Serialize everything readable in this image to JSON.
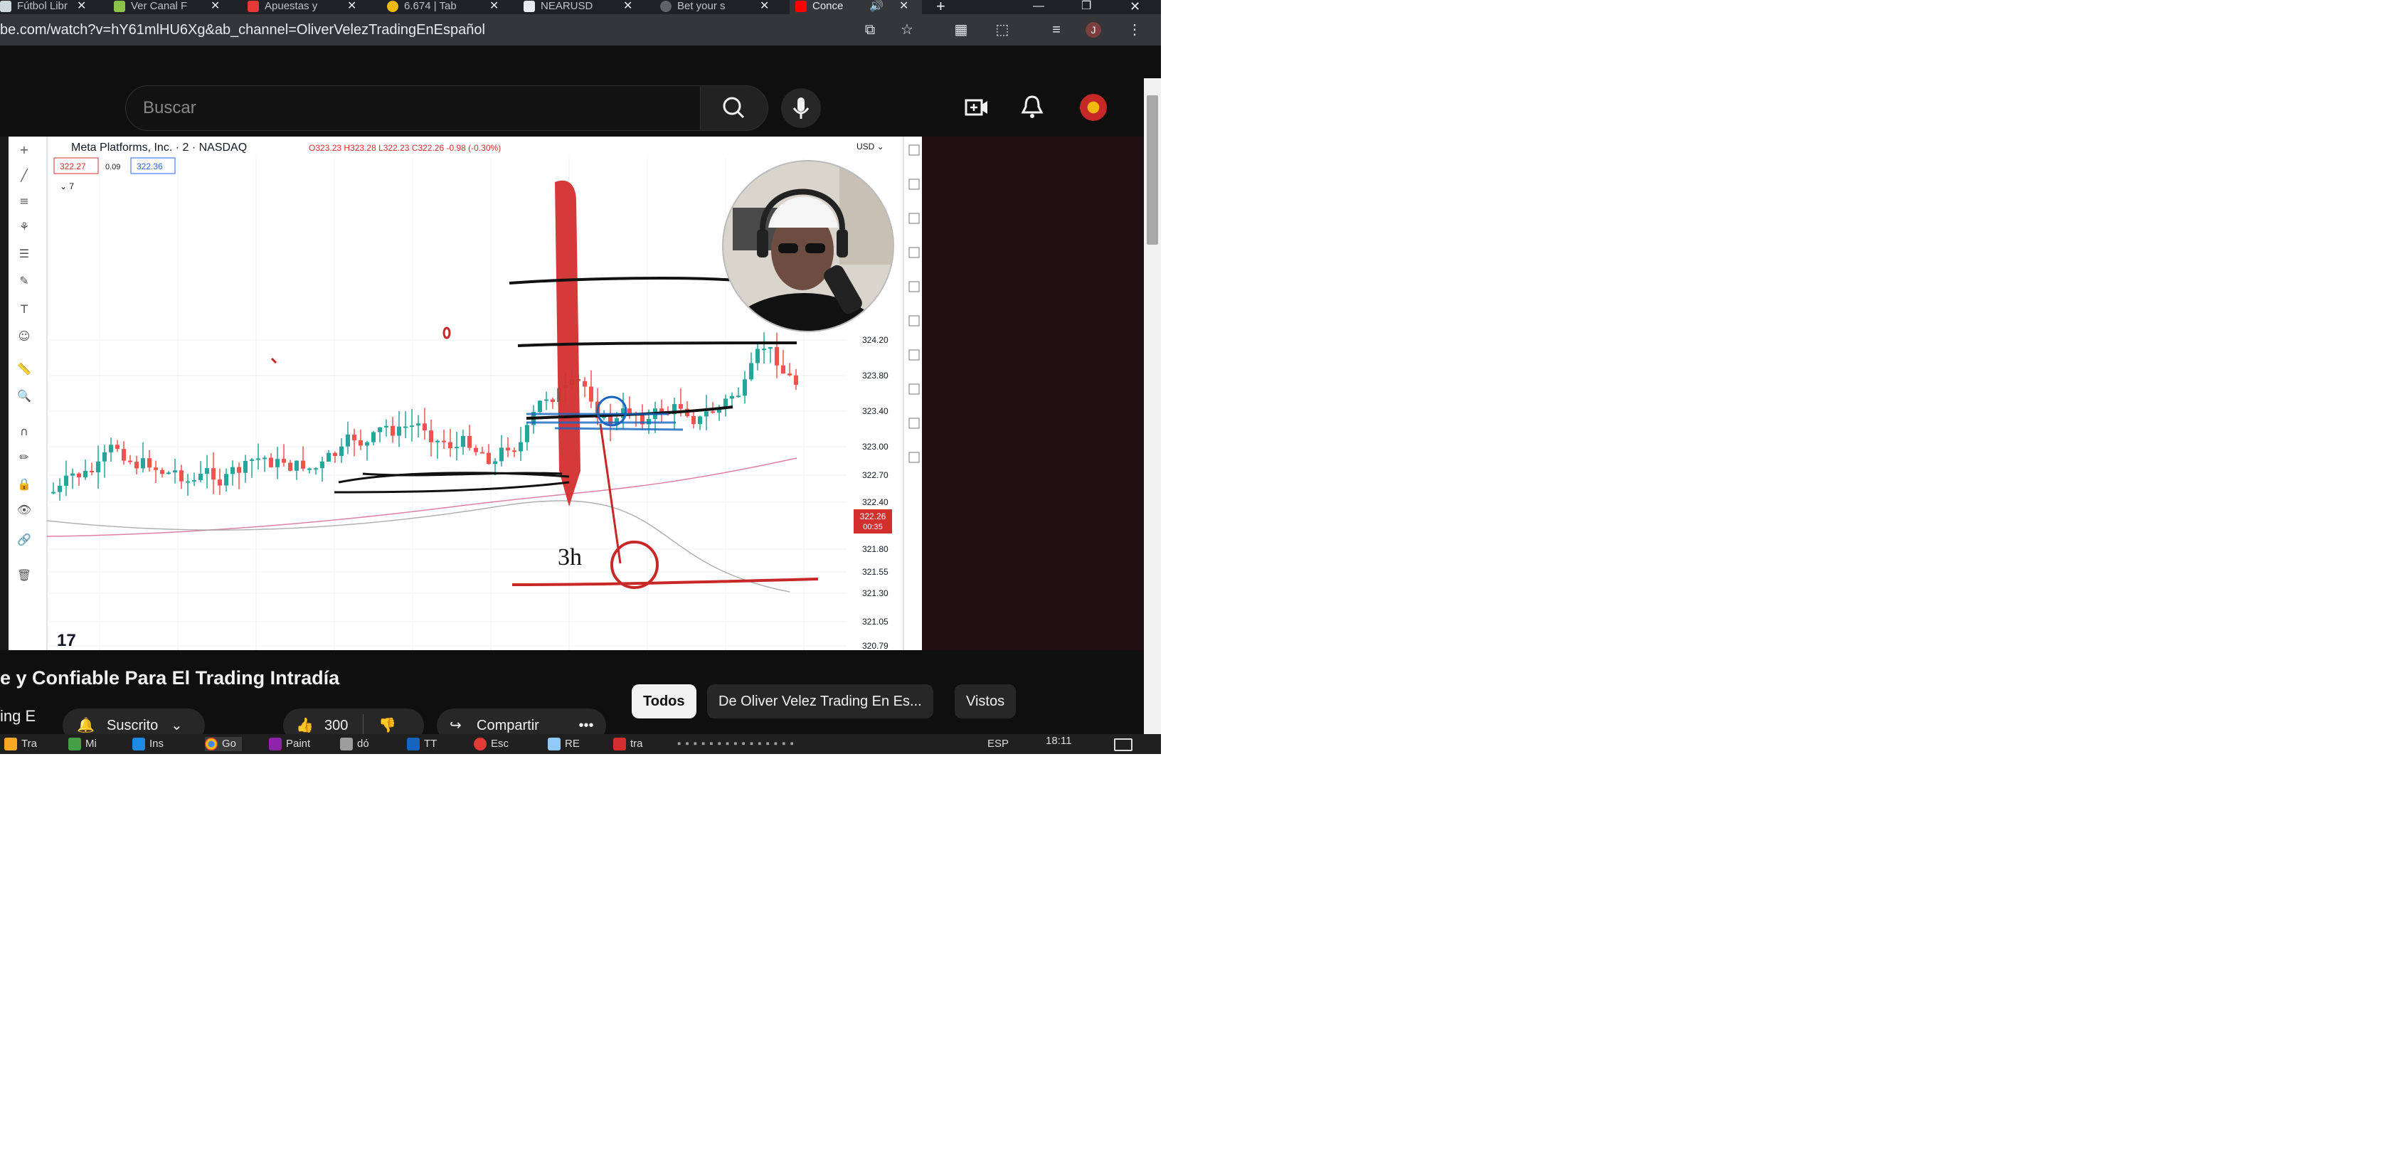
{
  "browser": {
    "tabs": [
      {
        "label": "Fútbol Libr",
        "color": "#cfd8dc"
      },
      {
        "label": "Ver Canal F",
        "color": "#8bc34a"
      },
      {
        "label": "Apuestas y",
        "color": "#e53935"
      },
      {
        "label": "6.674 | Tab",
        "color": "#f0b90b"
      },
      {
        "label": "NEARUSD",
        "color": "#e8eaed"
      },
      {
        "label": "Bet your s",
        "color": "#e8eaed"
      },
      {
        "label": "Conce",
        "color": "#ff0000"
      }
    ],
    "new_tab": "+",
    "url": "be.com/watch?v=hY61mlHU6Xg&ab_channel=OliverVelezTradingEnEspañol"
  },
  "youtube": {
    "search_placeholder": "Buscar",
    "video_title": "e y Confiable Para El Trading Intradía",
    "channel": "ing E",
    "subscribe": "Suscrito",
    "likes": "300",
    "share": "Compartir",
    "chips": [
      "Todos",
      "De Oliver Velez Trading En Es...",
      "Vistos"
    ]
  },
  "chart": {
    "symbol": "Meta Platforms, Inc. · 2 · NASDAQ",
    "ohlc": "O323.23 H323.28 L322.23 C322.26 -0.98 (-0.30%)",
    "bid": "322.27",
    "spread": "0.09",
    "ask": "322.36",
    "currency": "USD",
    "indicator_count": "7",
    "price_labels": [
      "324.20",
      "323.80",
      "323.40",
      "323.00",
      "322.70",
      "322.40",
      "321.80",
      "321.55",
      "321.30",
      "321.05",
      "320.79"
    ],
    "last_price": "322.26",
    "countdown": "00:35",
    "annotation": "3h"
  },
  "taskbar": {
    "items": [
      "Tra",
      "Mi",
      "Ins",
      "Go",
      "Paint",
      "dó",
      "TT",
      "Esc",
      "RE",
      "tra"
    ],
    "lang": "ESP",
    "time": "18:11"
  }
}
